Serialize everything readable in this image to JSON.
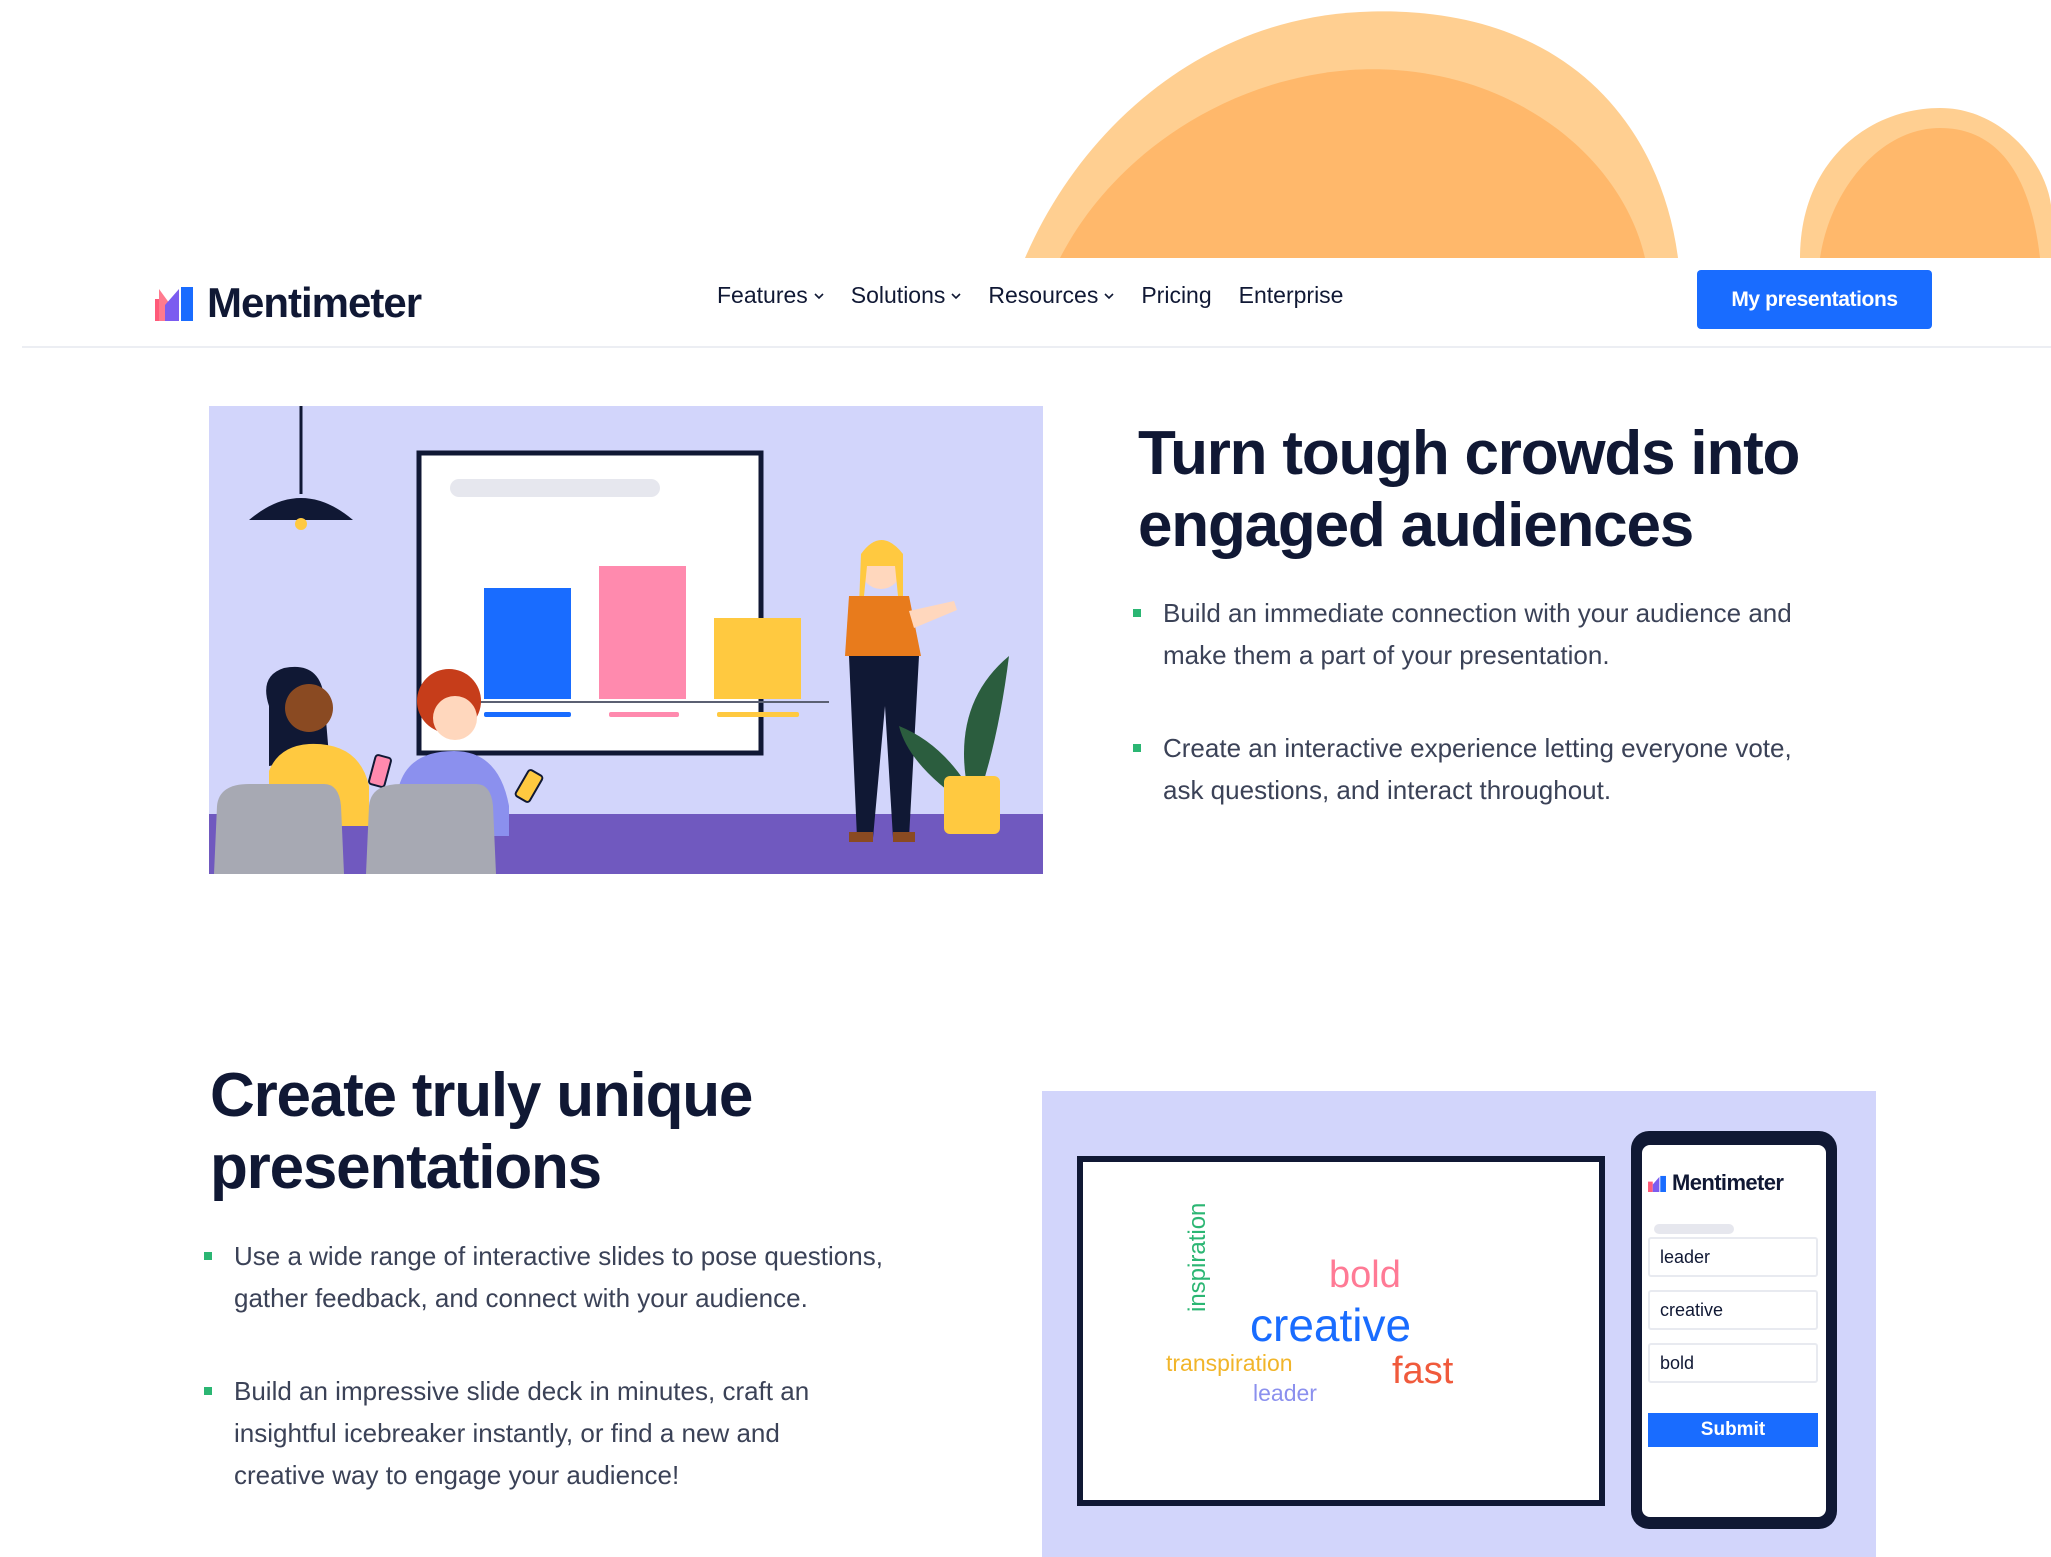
{
  "brand": {
    "name": "Mentimeter"
  },
  "nav": {
    "items": [
      {
        "label": "Features",
        "dropdown": true
      },
      {
        "label": "Solutions",
        "dropdown": true
      },
      {
        "label": "Resources",
        "dropdown": true
      },
      {
        "label": "Pricing",
        "dropdown": false
      },
      {
        "label": "Enterprise",
        "dropdown": false
      }
    ],
    "cta_label": "My presentations"
  },
  "section1": {
    "title_line1": "Turn tough crowds into",
    "title_line2": "engaged audiences",
    "bullets": [
      {
        "line1": "Build an immediate connection with your audience and",
        "line2": "make them a part of your presentation."
      },
      {
        "line1": "Create an interactive experience letting everyone vote,",
        "line2": "ask questions, and interact throughout."
      }
    ]
  },
  "section2": {
    "title_line1": "Create truly unique",
    "title_line2": "presentations",
    "bullets": [
      {
        "line1": "Use a wide range of interactive slides to pose questions,",
        "line2": "gather feedback, and connect with your audience.",
        "line3": ""
      },
      {
        "line1": "Build an impressive slide deck in minutes, craft an",
        "line2": "insightful icebreaker instantly, or find a new and",
        "line3": "creative way to engage your audience!"
      }
    ]
  },
  "word_cloud": {
    "words": [
      "inspiration",
      "bold",
      "creative",
      "transpiration",
      "fast",
      "leader"
    ]
  },
  "phone_form": {
    "brand": "Mentimeter",
    "fields": [
      "leader",
      "creative",
      "bold"
    ],
    "submit_label": "Submit"
  },
  "colors": {
    "primary": "#196cff",
    "text": "#101834",
    "bullet": "#2bb673",
    "illustration_bg": "#d2d5fb",
    "floor": "#7059bf",
    "blob_orange": "#ffb86b"
  },
  "icons": [
    "mentimeter-logo-icon",
    "chevron-down-icon",
    "bullet-square-icon"
  ]
}
